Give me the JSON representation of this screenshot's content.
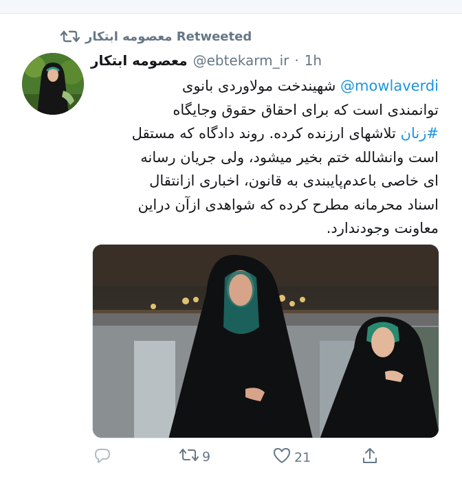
{
  "retweet_banner": {
    "label": "معصومه ابتکار Retweeted"
  },
  "tweet": {
    "author_name": "معصومه ابتکار",
    "handle": "@ebtekarm_ir",
    "separator": "·",
    "time": "1h",
    "mention": "@mowlaverdi",
    "text_lines": [
      "شهیندخت مولاوردی بانوی",
      "توانمندی است که برای احقاق حقوق وجایگاه",
      "تلاشهای ارزنده کرده. روند دادگاه که مستقل",
      "است وانشالله ختم بخیر میشود، ولی جریان رسانه",
      "ای خاصی باعدم‌پایبندی به قانون، اخباری ازانتقال",
      "اسناد محرمانه مطرح کرده که شواهدی ازآن دراین",
      "معاونت وجودندارد."
    ],
    "hashtag": "#زنان"
  },
  "actions": {
    "retweet_count": "9",
    "like_count": "21"
  },
  "icons": {
    "retweet": "retweet-icon",
    "reply": "reply-icon",
    "like": "heart-icon",
    "share": "share-icon"
  },
  "colors": {
    "link": "#1b95e0",
    "secondary_text": "#657786",
    "primary_text": "#14171a"
  }
}
